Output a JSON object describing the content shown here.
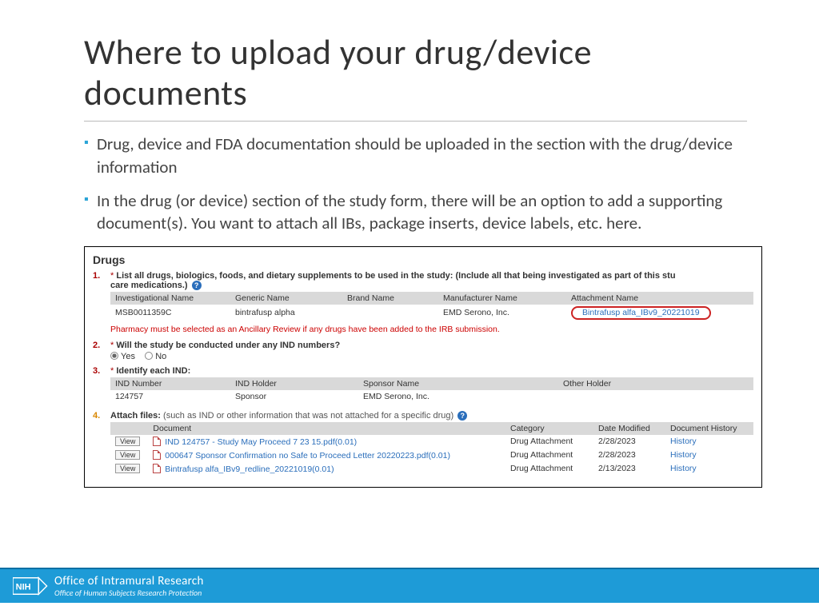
{
  "title": "Where to upload your drug/device documents",
  "bullets": [
    "Drug, device and FDA documentation should be uploaded in the section with the drug/device information",
    "In the drug (or device) section of the study form, there will be an option to add a supporting document(s). You want to attach all IBs, package inserts, device labels, etc.  here."
  ],
  "panel": {
    "heading": "Drugs",
    "q1": {
      "num": "1.",
      "text": "List all drugs, biologics, foods, and dietary supplements to be used in the study: (Include all that being investigated as part of this stu",
      "text2": "care medications.)",
      "cols": [
        "Investigational Name",
        "Generic Name",
        "Brand Name",
        "Manufacturer Name",
        "Attachment Name"
      ],
      "row": {
        "inv": "MSB0011359C",
        "gen": "bintrafusp alpha",
        "brand": "",
        "mfr": "EMD Serono, Inc.",
        "att": "Bintrafusp alfa_IBv9_20221019"
      },
      "warning": "Pharmacy must be selected as an Ancillary Review if any drugs have been added to the IRB submission."
    },
    "q2": {
      "num": "2.",
      "text": "Will the study be conducted under any IND numbers?",
      "yes": "Yes",
      "no": "No"
    },
    "q3": {
      "num": "3.",
      "text": "Identify each IND:",
      "cols": [
        "IND Number",
        "IND Holder",
        "Sponsor Name",
        "Other Holder"
      ],
      "row": {
        "num": "124757",
        "holder": "Sponsor",
        "sponsor": "EMD Serono, Inc.",
        "other": ""
      }
    },
    "q4": {
      "num": "4.",
      "text": "Attach files:",
      "sub": "(such as IND or other information that was not attached for a specific drug)",
      "cols": [
        "",
        "Document",
        "Category",
        "Date Modified",
        "Document History"
      ],
      "rows": [
        {
          "doc": "IND 124757 - Study May Proceed 7 23 15.pdf(0.01)",
          "cat": "Drug Attachment",
          "date": "2/28/2023",
          "hist": "History"
        },
        {
          "doc": "000647 Sponsor Confirmation no Safe to Proceed Letter 20220223.pdf(0.01)",
          "cat": "Drug Attachment",
          "date": "2/28/2023",
          "hist": "History"
        },
        {
          "doc": "Bintrafusp alfa_IBv9_redline_20221019(0.01)",
          "cat": "Drug Attachment",
          "date": "2/13/2023",
          "hist": "History"
        }
      ],
      "view": "View"
    }
  },
  "footer": {
    "l1": "Office of Intramural Research",
    "l2": "Office of Human Subjects Research Protection",
    "nih": "NIH"
  }
}
